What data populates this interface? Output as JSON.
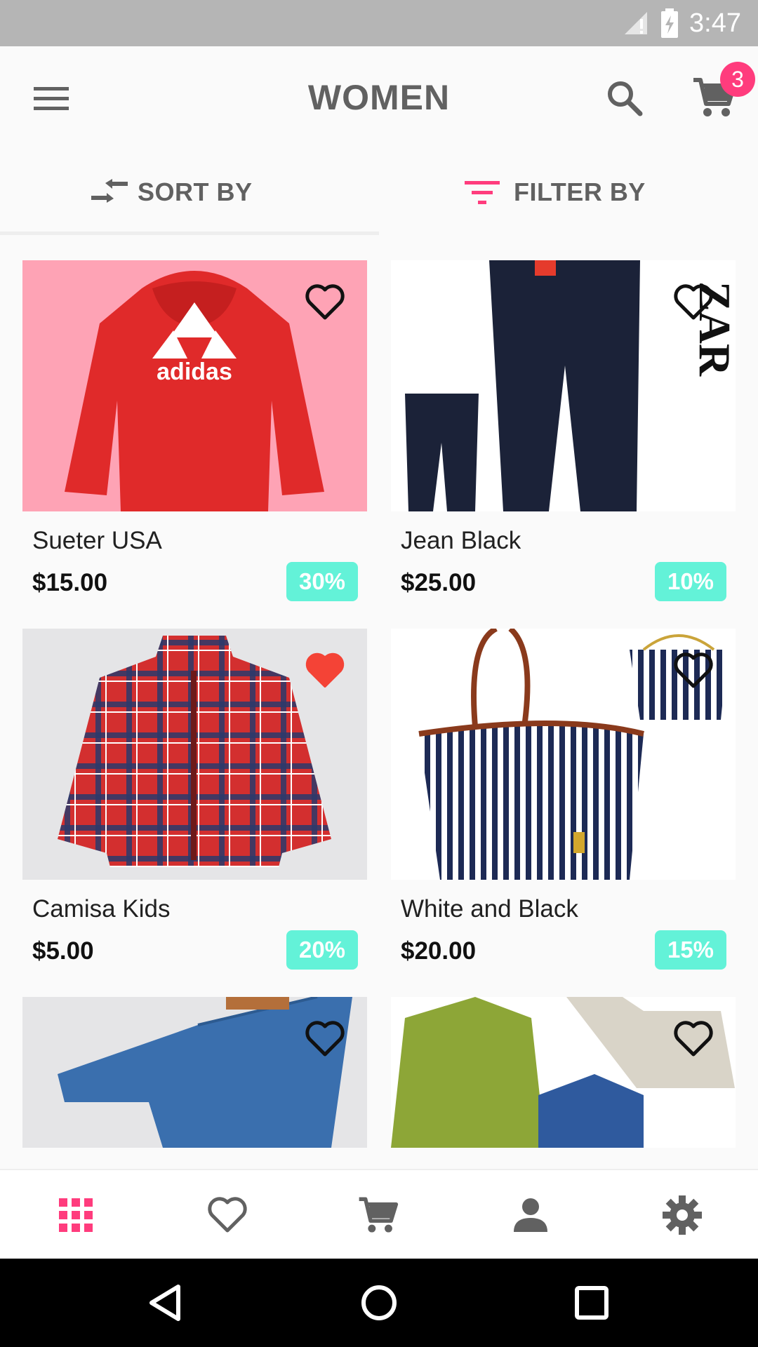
{
  "status": {
    "time": "3:47"
  },
  "header": {
    "title": "WOMEN",
    "cart_count": "3"
  },
  "toolbar": {
    "sort_label": "SORT BY",
    "filter_label": "FILTER BY"
  },
  "colors": {
    "accent": "#ff3c7d",
    "discount": "#63f2d8",
    "heart_filled": "#f44336"
  },
  "products": [
    {
      "name": "Sueter USA",
      "price": "$15.00",
      "discount": "30%",
      "favorite": false
    },
    {
      "name": "Jean Black",
      "price": "$25.00",
      "discount": "10%",
      "favorite": false
    },
    {
      "name": "Camisa Kids",
      "price": "$5.00",
      "discount": "20%",
      "favorite": true
    },
    {
      "name": "White and Black",
      "price": "$20.00",
      "discount": "15%",
      "favorite": false
    }
  ],
  "bottom_nav": [
    "grid-icon",
    "heart-icon",
    "cart-icon",
    "person-icon",
    "settings-icon"
  ]
}
